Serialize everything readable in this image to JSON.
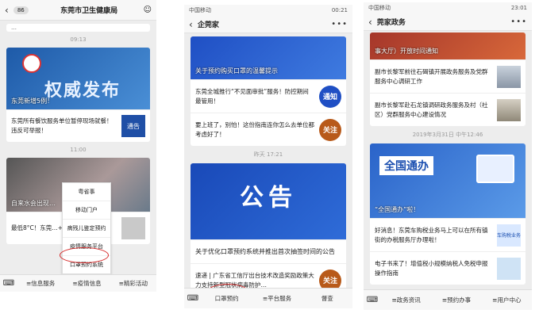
{
  "phone1": {
    "unread": "86",
    "title": "东莞市卫生健康局",
    "top_fragment": "…",
    "time1": "09:13",
    "hero_big": "权威发布",
    "hero_cap": "东莞新增5例！",
    "row1": "东莞所有餐饮服务单位暂停现场就餐！违反可举报！",
    "row1_thumb": "通告",
    "time2": "11:00",
    "hero2_cap": "自来水会出现…",
    "row2": "最低8°C！东莞…+降温”！防控…",
    "menu": [
      "粤省事",
      "移动门户",
      "病残儿鉴定预约",
      "疫情服务平台",
      "口罩预约系统"
    ],
    "bottom": [
      "≡信息服务",
      "≡疫情信息",
      "≡精彩活动"
    ]
  },
  "phone2": {
    "carrier": "中国移动",
    "clock": "00:21",
    "title": "企莞家",
    "hero1_cap": "关于预约购买口罩的温馨提示",
    "row1": "东莞全城推行“不见面审批”服务！防控期间最管用！",
    "row1_badge": "通知",
    "row2": "要上班了，别怕！这份指南连你怎么去单位都考虑好了！",
    "row2_badge": "关注",
    "time": "昨天 17:21",
    "hero2_big": "公告",
    "hero2_cap": "关于优化口罩预约系统并推出首次抽签时间的公告",
    "row3": "速递 | 广东省工信厅出台技术改造奖励政策大力支持新型冠状病毒防护…",
    "row3_badge": "关注",
    "bottom": [
      "口罩预约",
      "≡平台服务",
      "督查"
    ]
  },
  "phone3": {
    "carrier": "中国移动",
    "clock": "23:01",
    "title": "莞家政务",
    "top_cap": "事大厅）开放时间通知",
    "row1": "副市长黎军前往石碣镇开展政务服务及党群服务中心调研工作",
    "row2": "副市长黎军赴石龙镇调研政务服务及村（社区）党群服务中心建设情况",
    "time": "2019年3月31日 中午12:46",
    "hero_big": "全国通办",
    "hero_cap": "“全国通办”啦！",
    "row3": "好消息！东莞车购税业务马上可以在所有镇街的办税服务厅办理啦！",
    "row3_thumb": "车购税业务",
    "row4": "电子书来了！增值税小规模纳税人免税申报操作指南",
    "bottom": [
      "≡政务资讯",
      "≡预约办事",
      "≡用户中心"
    ]
  }
}
